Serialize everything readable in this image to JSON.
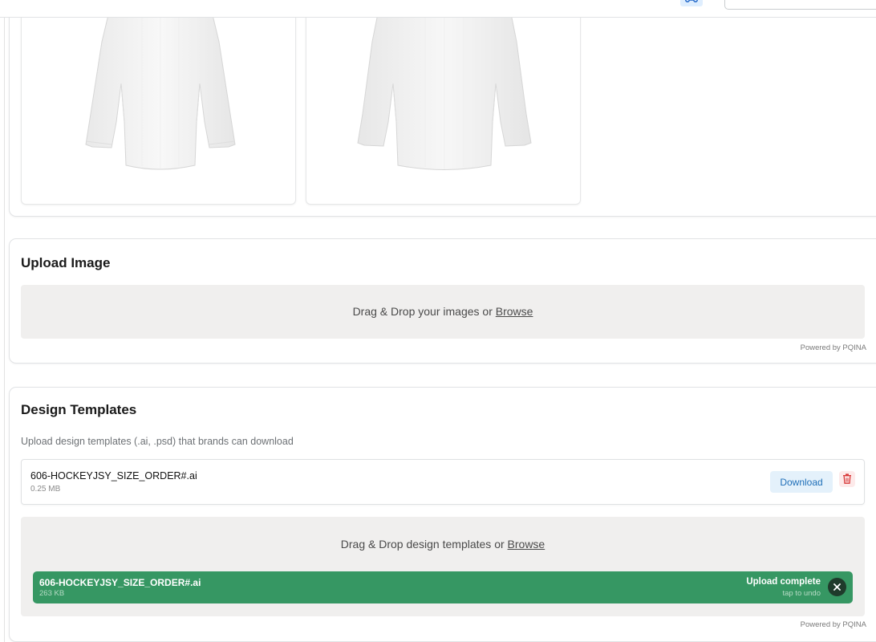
{
  "upload_image": {
    "title": "Upload Image",
    "dropzone_text": "Drag & Drop your images or",
    "browse_label": "Browse",
    "powered_by": "Powered by PQINA"
  },
  "design_templates": {
    "title": "Design Templates",
    "description": "Upload design templates (.ai, .psd) that brands can download",
    "file": {
      "name": "606-HOCKEYJSY_SIZE_ORDER#.ai",
      "size": "0.25 MB",
      "download_label": "Download"
    },
    "dropzone_text": "Drag & Drop design templates or",
    "browse_label": "Browse",
    "upload_item": {
      "name": "606-HOCKEYJSY_SIZE_ORDER#.ai",
      "size": "263 KB",
      "status": "Upload complete",
      "action_hint": "tap to undo"
    },
    "powered_by": "Powered by PQINA"
  },
  "colors": {
    "upload_success": "#369763",
    "download_button_bg": "#e4f1fb",
    "download_button_text": "#1f6fb8",
    "dropzone_bg": "#f0efee",
    "delete_icon": "#d83a3a"
  },
  "icons": {
    "topbar_button": "route-icon",
    "delete": "trash-icon",
    "cancel_upload": "close-icon"
  }
}
